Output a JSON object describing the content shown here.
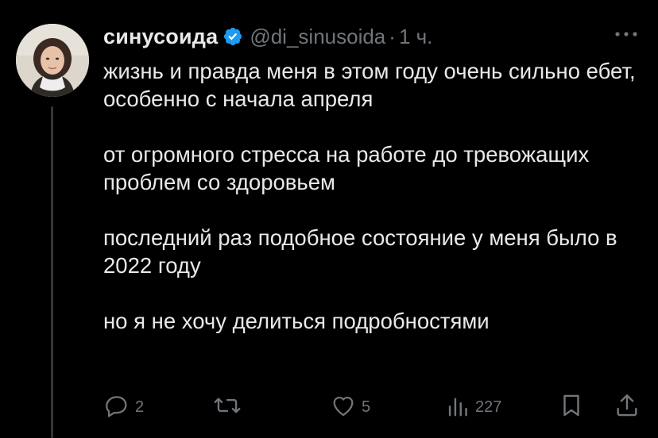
{
  "tweet": {
    "author": {
      "display_name": "синусоида",
      "handle": "@di_sinusoida",
      "verified": true
    },
    "separator": "·",
    "time": "1 ч.",
    "paragraphs": [
      "жизнь и правда меня в этом году очень сильно ебет, особенно с начала апреля",
      "от огромного стресса на работе до тревожащих проблем со здоровьем",
      "последний раз подобное состояние у меня было в 2022 году",
      "но я не хочу делиться подробностями"
    ]
  },
  "actions": {
    "reply_count": "2",
    "retweet_count": "",
    "like_count": "5",
    "views_count": "227"
  },
  "icons": {
    "verified": "verified-badge-icon",
    "more": "more-horizontal-icon",
    "reply": "reply-icon",
    "retweet": "retweet-icon",
    "like": "heart-icon",
    "views": "views-chart-icon",
    "bookmark": "bookmark-icon",
    "share": "share-icon"
  },
  "colors": {
    "background": "#000000",
    "text": "#e7e9ea",
    "secondary": "#71767b",
    "verified": "#1d9bf0"
  }
}
